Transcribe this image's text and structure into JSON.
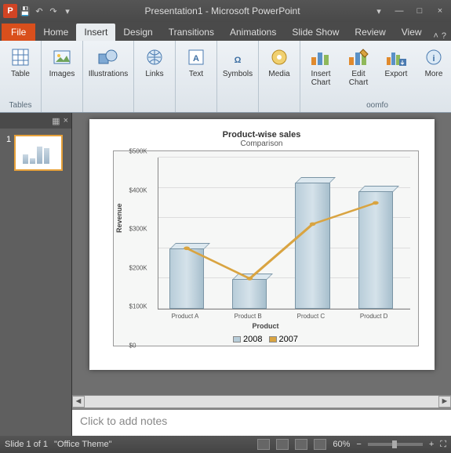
{
  "title": "Presentation1 - Microsoft PowerPoint",
  "qat": {
    "save": "💾",
    "undo": "↶",
    "redo": "↷"
  },
  "winctrl": {
    "min": "—",
    "max": "□",
    "close": "×",
    "rmin": "▾"
  },
  "tabs": {
    "file": "File",
    "home": "Home",
    "insert": "Insert",
    "design": "Design",
    "transitions": "Transitions",
    "animations": "Animations",
    "slideshow": "Slide Show",
    "review": "Review",
    "view": "View"
  },
  "ribbon": {
    "table": "Table",
    "images": "Images",
    "illustrations": "Illustrations",
    "links": "Links",
    "text": "Text",
    "symbols": "Symbols",
    "media": "Media",
    "insertchart": "Insert\nChart",
    "editchart": "Edit\nChart",
    "export": "Export",
    "more": "More",
    "group_tables": "Tables",
    "group_oomfo": "oomfo"
  },
  "thumb": {
    "num": "1"
  },
  "notes_placeholder": "Click to add notes",
  "status": {
    "slide": "Slide 1 of 1",
    "theme": "\"Office Theme\"",
    "zoom": "60%"
  },
  "chart_data": {
    "type": "bar",
    "title": "Product-wise sales",
    "subtitle": "Comparison",
    "xlabel": "Product",
    "ylabel": "Revenue",
    "categories": [
      "Product A",
      "Product B",
      "Product C",
      "Product D"
    ],
    "yticks": [
      "$0",
      "$100K",
      "$200K",
      "$300K",
      "$400K",
      "$500K"
    ],
    "ylim": [
      0,
      500000
    ],
    "series": [
      {
        "name": "2008",
        "values": [
          220000,
          110000,
          460000,
          430000
        ],
        "color": "#b8cdd9"
      },
      {
        "name": "2007",
        "values": [
          200000,
          100000,
          280000,
          350000
        ],
        "color": "#d9a441"
      }
    ]
  }
}
